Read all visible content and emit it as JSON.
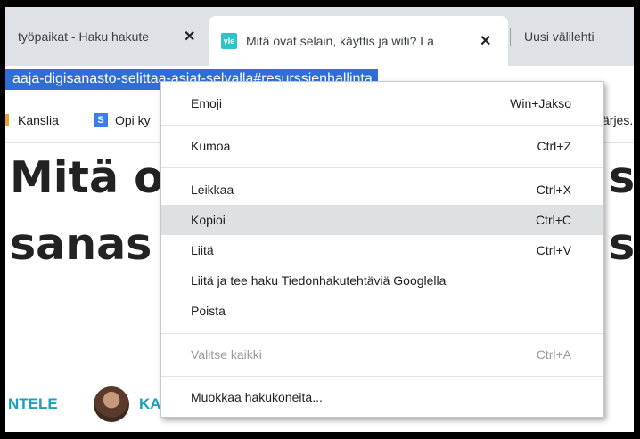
{
  "tabs": [
    {
      "title": "työpaikat - Haku hakute",
      "close": "✕"
    },
    {
      "favicon": "yle",
      "title": "Mitä ovat selain, käyttis ja wifi? La",
      "close": "✕"
    },
    {
      "title": "Uusi välilehti"
    }
  ],
  "address_bar": {
    "url": "aaja-digisanasto-selittaa-asiat-selvalla#resurssienhallinta"
  },
  "bookmarks": [
    {
      "label": "Kanslia"
    },
    {
      "icon_letter": "S",
      "label": "Opi ky"
    },
    {
      "label": "ärjes..."
    }
  ],
  "page": {
    "headline_line1_left": "Mitä o",
    "headline_line1_right": "s",
    "headline_line2_left": "sanas",
    "headline_line2_right": "s",
    "share_label": "NTELE",
    "author_partial": "KA"
  },
  "context_menu": {
    "items": [
      {
        "label": "Emoji",
        "shortcut": "Win+Jakso"
      },
      {
        "label": "Kumoa",
        "shortcut": "Ctrl+Z"
      },
      {
        "label": "Leikkaa",
        "shortcut": "Ctrl+X"
      },
      {
        "label": "Kopioi",
        "shortcut": "Ctrl+C",
        "highlighted": true
      },
      {
        "label": "Liitä",
        "shortcut": "Ctrl+V"
      },
      {
        "label": "Liitä ja tee haku Tiedonhakutehtäviä Googlella",
        "shortcut": ""
      },
      {
        "label": "Poista",
        "shortcut": ""
      },
      {
        "label": "Valitse kaikki",
        "shortcut": "Ctrl+A",
        "disabled": true
      },
      {
        "label": "Muokkaa hakukoneita...",
        "shortcut": ""
      }
    ]
  },
  "colors": {
    "selection": "#2f6ed8",
    "accent": "#1aa2b9",
    "menu_highlight": "#dfe0e2"
  }
}
